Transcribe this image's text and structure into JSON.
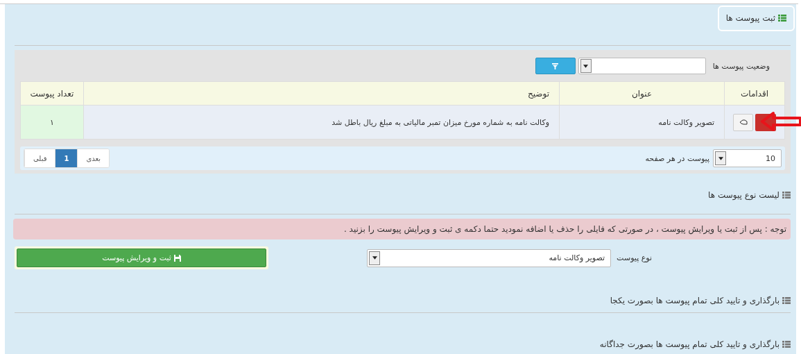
{
  "header_tab": {
    "title": "ثبت پیوست ها"
  },
  "filter": {
    "label": "وضعیت پیوست ها"
  },
  "table": {
    "columns": [
      "اقدامات",
      "عنوان",
      "توضیح",
      "تعداد پیوست"
    ],
    "rows": [
      {
        "title": "تصویر وکالت نامه",
        "description": "وکالت نامه به شماره مورخ میزان تمبر مالیاتی به مبلغ ریال باطل شد",
        "count": "۱"
      }
    ]
  },
  "page_size": {
    "value": "10",
    "label": "پیوست در هر صفحه"
  },
  "pager": [
    {
      "label": "بعدی",
      "selected": false
    },
    {
      "label": "1",
      "selected": true
    },
    {
      "label": "قبلی",
      "selected": false
    }
  ],
  "type_list": {
    "title": "لیست نوع پیوست ها"
  },
  "alert": "توجه : پس از ثبت یا ویرایش پیوست ، در صورتی که فایلی را حذف یا اضافه نمودید حتما دکمه ی ثبت و ویرایش پیوست را بزنید .",
  "attachment_type": {
    "label": "نوع پیوست",
    "value": "تصویر وکالت نامه"
  },
  "save_button": "ثبت و ویرایش پیوست",
  "sections": [
    "بارگذاری و تایید کلی تمام پیوست ها بصورت یکجا",
    "بارگذاری و تایید کلی تمام پیوست ها بصورت جداگانه"
  ]
}
